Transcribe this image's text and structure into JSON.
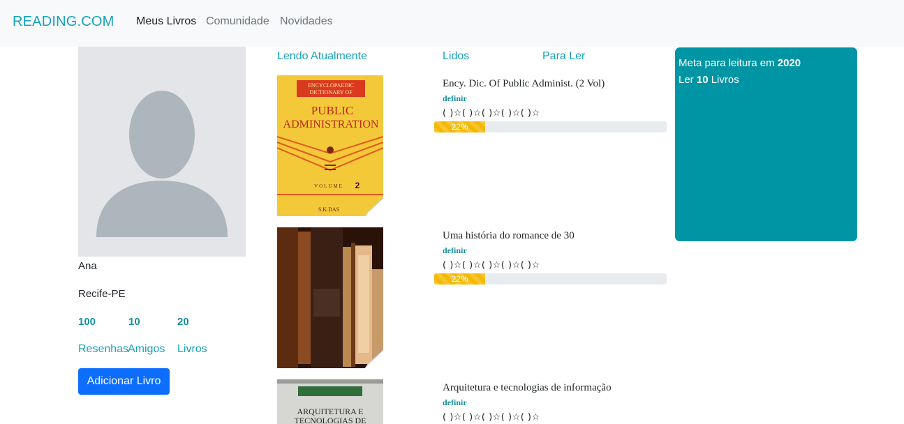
{
  "navbar": {
    "brand": "READING.COM",
    "links": [
      {
        "label": "Meus Livros",
        "active": true
      },
      {
        "label": "Comunidade",
        "active": false
      },
      {
        "label": "Novidades",
        "active": false
      }
    ]
  },
  "profile": {
    "name": "Ana",
    "location": "Recife-PE",
    "stats": [
      {
        "value": "100",
        "label": "Resenhas"
      },
      {
        "value": "10",
        "label": "Amigos"
      },
      {
        "value": "20",
        "label": "Livros"
      }
    ],
    "add_button": "Adicionar Livro"
  },
  "tabs": [
    "Lendo Atualmente",
    "Lidos",
    "Para Ler"
  ],
  "books": [
    {
      "title": "Ency. Dic. Of Public Administ. (2 Vol)",
      "rate_link": "definir",
      "rating_text": "( )☆( )☆( )☆( )☆( )☆",
      "progress_label": "22%",
      "progress": 0.22,
      "cover": {
        "top_text_1": "ENCYCLOPAEDIC",
        "top_text_2": "DICTIONARY OF",
        "main_1": "PUBLIC",
        "main_2": "ADMINISTRATION",
        "volume": "VOLUME",
        "vol_num": "2",
        "author": "S.K.DAS"
      }
    },
    {
      "title": "Uma história do romance de 30",
      "rate_link": "definir",
      "rating_text": "( )☆( )☆( )☆( )☆( )☆",
      "progress_label": "22%",
      "progress": 0.22
    },
    {
      "title": "Arquitetura e tecnologias de informação",
      "rate_link": "definir",
      "rating_text": "( )☆( )☆( )☆( )☆( )☆",
      "cover": {
        "main_1": "ARQUITETURA E",
        "main_2": "TECNOLOGIAS DE"
      }
    }
  ],
  "goal": {
    "prefix": "Meta para leitura em ",
    "year": "2020",
    "read_prefix": "Ler ",
    "count": "10",
    "read_suffix": " Livros"
  },
  "colors": {
    "accent": "#17a2b8",
    "goal_bg": "#0095a4",
    "primary": "#0d6efd",
    "progress": "#f5b800"
  }
}
